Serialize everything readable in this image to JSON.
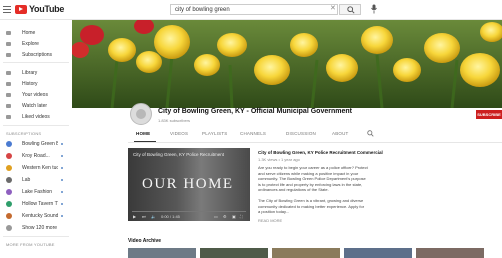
{
  "app": {
    "logo_text": "YouTube",
    "search_value": "city of bowling green"
  },
  "sidebar": {
    "main": [
      {
        "label": "Home"
      },
      {
        "label": "Explore"
      },
      {
        "label": "Subscriptions"
      }
    ],
    "library": [
      {
        "label": "Library"
      },
      {
        "label": "History"
      },
      {
        "label": "Your videos"
      },
      {
        "label": "Watch later"
      },
      {
        "label": "Liked videos"
      }
    ],
    "subscriptions_heading": "SUBSCRIPTIONS",
    "subscriptions": [
      {
        "label": "Bowling Green Ba...",
        "color": "#4b7bd1"
      },
      {
        "label": "Kroy Road...",
        "color": "#d64545"
      },
      {
        "label": "Western Ken tuck...",
        "color": "#e0a020"
      },
      {
        "label": "Lab",
        "color": "#6b6b6b"
      },
      {
        "label": "Lake Fashion",
        "color": "#8e5fbf"
      },
      {
        "label": "Hollow Tavern TV",
        "color": "#2f9e6b"
      },
      {
        "label": "Kentucky Sounds",
        "color": "#c46a2f"
      },
      {
        "label": "Show 120 more",
        "color": "#999999"
      }
    ],
    "more_heading": "MORE FROM YOUTUBE"
  },
  "channel": {
    "name": "City of Bowling Green, KY - Official Municipal Government",
    "subscribers": "1.83K subscribers",
    "subscribe_label": "SUBSCRIBE"
  },
  "tabs": [
    {
      "label": "HOME",
      "active": true
    },
    {
      "label": "VIDEOS",
      "active": false
    },
    {
      "label": "PLAYLISTS",
      "active": false
    },
    {
      "label": "CHANNELS",
      "active": false
    },
    {
      "label": "DISCUSSION",
      "active": false
    },
    {
      "label": "ABOUT",
      "active": false
    }
  ],
  "featured_video": {
    "player_title": "City of Bowling Green, KY Police Recruitment",
    "overlay_text": "OUR HOME",
    "time": "0:00 / 1:45",
    "title": "City of Bowling Green, KY Police Recruitment Commercial",
    "meta": "1.3K views • 1 year ago",
    "description_lines": [
      "Are you ready to begin your career as a police officer? Protect",
      "and serve citizens while making a positive impact in your",
      "community. The Bowling Green Police Department's purpose",
      "is to protect life and property by enforcing laws in the state,",
      "ordinances and regulations of the State.",
      "",
      "The City of Bowling Green is a vibrant, growing and diverse",
      "community dedicated to making better experience. Apply for",
      "a position today..."
    ],
    "read_more": "READ MORE"
  },
  "section": {
    "title": "Video Archive"
  }
}
